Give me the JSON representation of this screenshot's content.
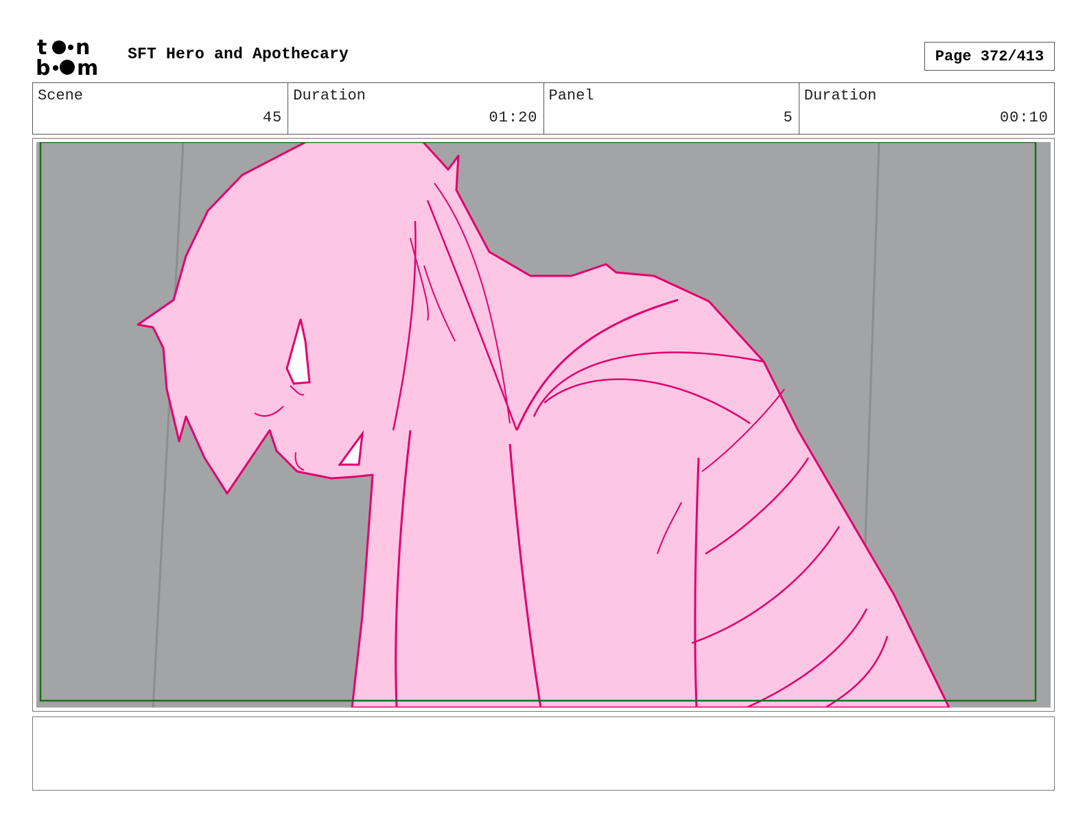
{
  "header": {
    "project_title": "SFT Hero and Apothecary",
    "page_label": "Page 372/413",
    "logo_icon": "toon-boom-logo"
  },
  "info": {
    "scene_label": "Scene",
    "scene_value": "45",
    "scene_duration_label": "Duration",
    "scene_duration_value": "01:20",
    "panel_label": "Panel",
    "panel_value": "5",
    "panel_duration_label": "Duration",
    "panel_duration_value": "00:10"
  },
  "panel": {
    "background_color": "#a3a4a5",
    "figure_fill_color": "#fcc6e4",
    "line_color": "#e0006c",
    "safe_frame_color": "#1a6b1a"
  },
  "notes": {
    "text": ""
  }
}
